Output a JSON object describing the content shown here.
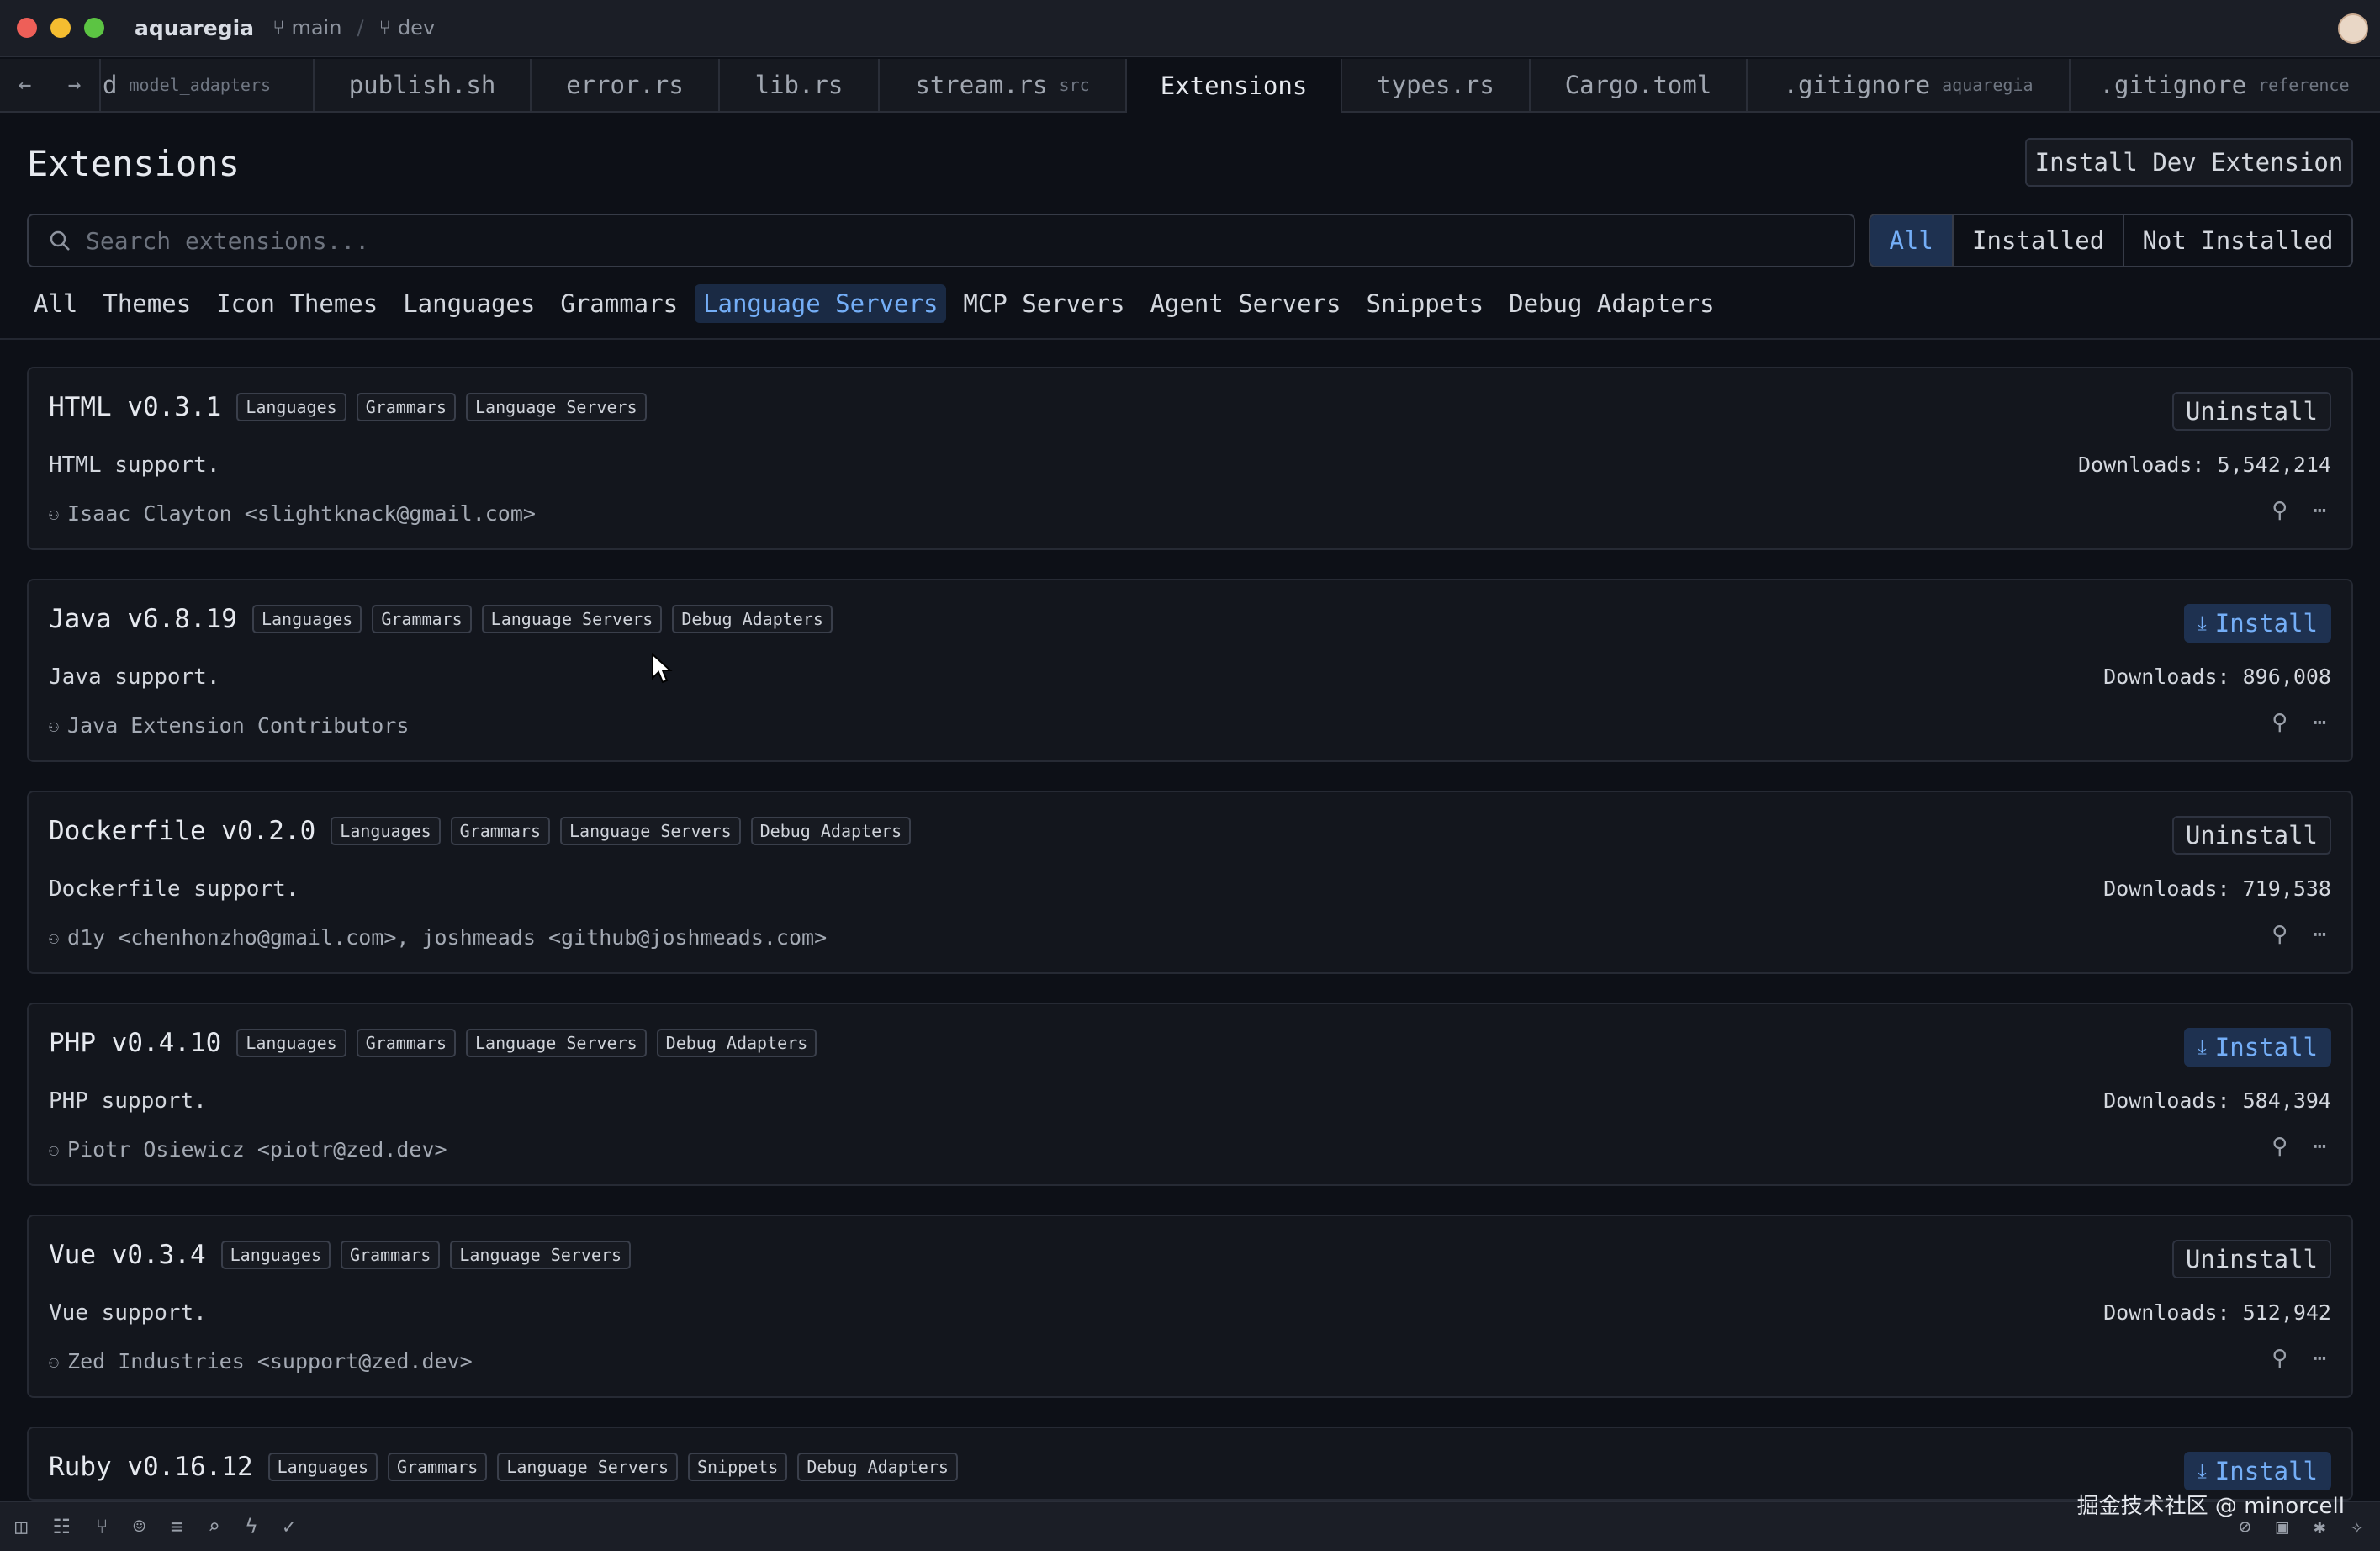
{
  "titlebar": {
    "project": "aquaregia",
    "branch": "main",
    "sep": "/",
    "worktree": "dev"
  },
  "tabs": [
    {
      "label": "d",
      "sub": "model_adapters"
    },
    {
      "label": "publish.sh",
      "sub": ""
    },
    {
      "label": "error.rs",
      "sub": ""
    },
    {
      "label": "lib.rs",
      "sub": ""
    },
    {
      "label": "stream.rs",
      "sub": "src"
    },
    {
      "label": "Extensions",
      "sub": ""
    },
    {
      "label": "types.rs",
      "sub": ""
    },
    {
      "label": "Cargo.toml",
      "sub": ""
    },
    {
      "label": ".gitignore",
      "sub": "aquaregia"
    },
    {
      "label": ".gitignore",
      "sub": "reference"
    }
  ],
  "page": {
    "title": "Extensions",
    "dev_button": "Install Dev Extension"
  },
  "search": {
    "placeholder": "Search extensions..."
  },
  "install_filter": {
    "all": "All",
    "installed": "Installed",
    "not_installed": "Not Installed"
  },
  "categories": [
    "All",
    "Themes",
    "Icon Themes",
    "Languages",
    "Grammars",
    "Language Servers",
    "MCP Servers",
    "Agent Servers",
    "Snippets",
    "Debug Adapters"
  ],
  "extensions": [
    {
      "name": "HTML v0.3.1",
      "tags": [
        "Languages",
        "Grammars",
        "Language Servers"
      ],
      "description": "HTML support.",
      "author": "Isaac Clayton <slightknack@gmail.com>",
      "action": "Uninstall",
      "downloads": "Downloads: 5,542,214"
    },
    {
      "name": "Java v6.8.19",
      "tags": [
        "Languages",
        "Grammars",
        "Language Servers",
        "Debug Adapters"
      ],
      "description": "Java support.",
      "author": "Java Extension Contributors",
      "action": "Install",
      "downloads": "Downloads: 896,008"
    },
    {
      "name": "Dockerfile v0.2.0",
      "tags": [
        "Languages",
        "Grammars",
        "Language Servers",
        "Debug Adapters"
      ],
      "description": "Dockerfile support.",
      "author": "d1y <chenhonzho@gmail.com>, joshmeads <github@joshmeads.com>",
      "action": "Uninstall",
      "downloads": "Downloads: 719,538"
    },
    {
      "name": "PHP v0.4.10",
      "tags": [
        "Languages",
        "Grammars",
        "Language Servers",
        "Debug Adapters"
      ],
      "description": "PHP support.",
      "author": "Piotr Osiewicz <piotr@zed.dev>",
      "action": "Install",
      "downloads": "Downloads: 584,394"
    },
    {
      "name": "Vue v0.3.4",
      "tags": [
        "Languages",
        "Grammars",
        "Language Servers"
      ],
      "description": "Vue support.",
      "author": "Zed Industries <support@zed.dev>",
      "action": "Uninstall",
      "downloads": "Downloads: 512,942"
    },
    {
      "name": "Ruby v0.16.12",
      "tags": [
        "Languages",
        "Grammars",
        "Language Servers",
        "Snippets",
        "Debug Adapters"
      ],
      "description": "",
      "author": "",
      "action": "Install",
      "downloads": ""
    }
  ],
  "watermark": "掘金技术社区 @ minorcell",
  "colors": {
    "accent": "#74aef7",
    "background": "#0d1017",
    "card": "#13161d"
  }
}
